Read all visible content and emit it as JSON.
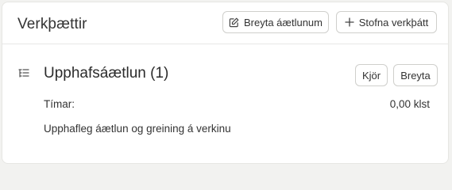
{
  "card": {
    "title": "Verkþættir"
  },
  "header_actions": {
    "edit_plan_label": "Breyta áætlunum",
    "create_phase_label": "Stofna verkþátt"
  },
  "phase": {
    "title": "Upphafsáætlun (1)",
    "run_label": "Kjör",
    "edit_label": "Breyta",
    "hours_label": "Tímar:",
    "hours_value": "0,00 klst",
    "description": "Upphafleg áætlun og greining á verkinu"
  },
  "icons": {
    "edit_plan": "pencil-square-icon",
    "create_phase": "plus-icon",
    "phase": "list-tree-icon"
  }
}
